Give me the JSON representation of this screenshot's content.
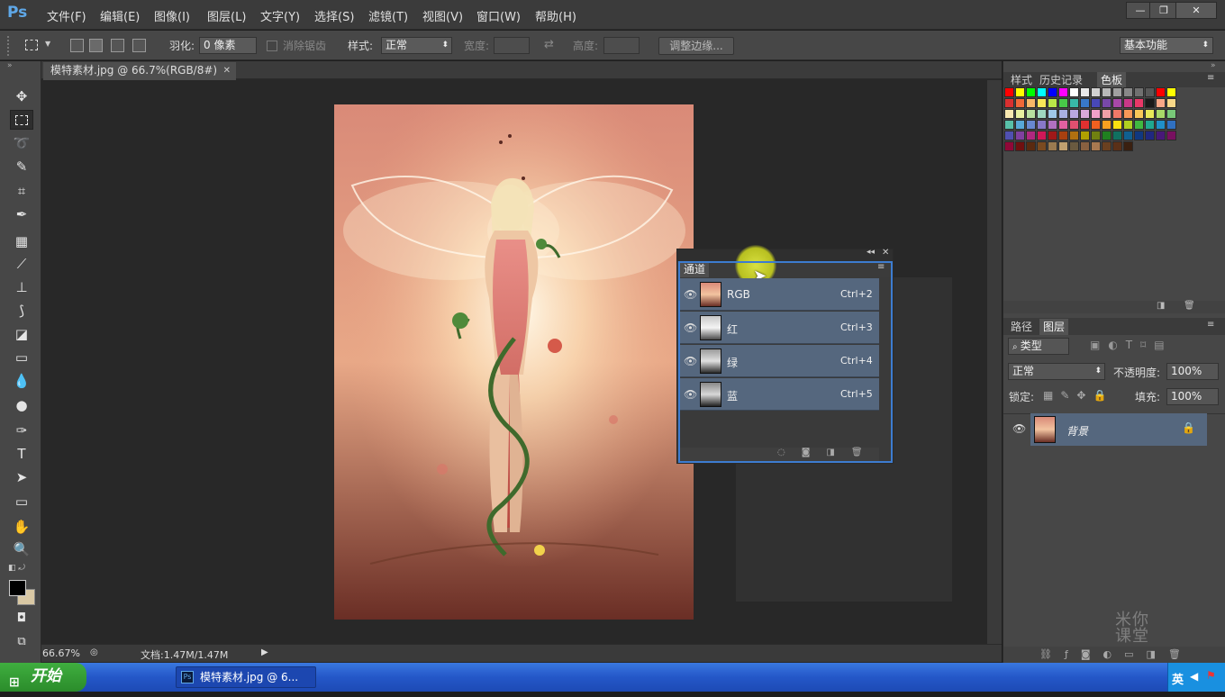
{
  "app": {
    "logo": "Ps"
  },
  "menu": [
    "文件(F)",
    "编辑(E)",
    "图像(I)",
    "图层(L)",
    "文字(Y)",
    "选择(S)",
    "滤镜(T)",
    "视图(V)",
    "窗口(W)",
    "帮助(H)"
  ],
  "window_controls": {
    "minimize": "—",
    "restore": "❐",
    "close": "✕"
  },
  "options": {
    "feather_label": "羽化:",
    "feather_value": "0 像素",
    "antialias_label": "消除锯齿",
    "style_label": "样式:",
    "style_value": "正常",
    "width_label": "宽度:",
    "height_label": "高度:",
    "refine_edge": "调整边缘...",
    "workspace": "基本功能"
  },
  "document": {
    "tab_title": "模特素材.jpg @ 66.7%(RGB/8#)",
    "zoom": "66.67%",
    "doc_size": "文档:1.47M/1.47M"
  },
  "right_top_tabs": [
    "样式",
    "历史记录",
    "色板"
  ],
  "right_mid_tabs": [
    "路径",
    "图层"
  ],
  "swatch_colors": [
    "#ff0000",
    "#ffff00",
    "#00ff00",
    "#00ffff",
    "#0000ff",
    "#ff00ff",
    "#ffffff",
    "#e8e8e8",
    "#d0d0d0",
    "#b8b8b8",
    "#a0a0a0",
    "#888888",
    "#707070",
    "#585858",
    "#ff0000",
    "#ffff00",
    "#d83030",
    "#f06838",
    "#f8b868",
    "#f8e858",
    "#b8e848",
    "#48c848",
    "#38b8a8",
    "#3878c8",
    "#4848b8",
    "#7848a8",
    "#a848a8",
    "#c83888",
    "#e83868",
    "#1a1a1a",
    "#f8a888",
    "#f8d888",
    "#f8e8b0",
    "#e8f0a0",
    "#b8e0a0",
    "#a0d8c0",
    "#a0c8e8",
    "#a8b0e0",
    "#b8a8e0",
    "#d8a8d8",
    "#f0a0c8",
    "#f0a0a8",
    "#f07868",
    "#f89858",
    "#f8c858",
    "#e8e858",
    "#a8d868",
    "#78c878",
    "#58c0a8",
    "#58a8d8",
    "#6888d0",
    "#8878c8",
    "#b070c0",
    "#e060a0",
    "#e05070",
    "#e03030",
    "#f06020",
    "#f8a020",
    "#f8e010",
    "#b0d020",
    "#40b840",
    "#20a890",
    "#2090c8",
    "#3070c0",
    "#5050b0",
    "#8040a0",
    "#b02880",
    "#d01858",
    "#a01818",
    "#a84010",
    "#b07010",
    "#b0a000",
    "#708010",
    "#208020",
    "#107060",
    "#106090",
    "#103880",
    "#202880",
    "#481878",
    "#781060",
    "#900838",
    "#701010",
    "#5a2a10",
    "#7a4a20",
    "#9a7a50",
    "#c0a070",
    "#6a5a40",
    "#886040",
    "#a87850",
    "#6a4020",
    "#5a3018",
    "#3a2010"
  ],
  "channels": {
    "tab_label": "通道",
    "rows": [
      {
        "name": "RGB",
        "shortcut": "Ctrl+2"
      },
      {
        "name": "红",
        "shortcut": "Ctrl+3"
      },
      {
        "name": "绿",
        "shortcut": "Ctrl+4"
      },
      {
        "name": "蓝",
        "shortcut": "Ctrl+5"
      }
    ]
  },
  "layers": {
    "kind_filter": "类型",
    "blend_mode": "正常",
    "opacity_label": "不透明度:",
    "opacity_value": "100%",
    "lock_label": "锁定:",
    "fill_label": "填充:",
    "fill_value": "100%",
    "layer_name": "背景"
  },
  "watermark": "米你课堂",
  "taskbar": {
    "start": "开始",
    "window_item": "模特素材.jpg @ 6...",
    "ime": "英"
  }
}
